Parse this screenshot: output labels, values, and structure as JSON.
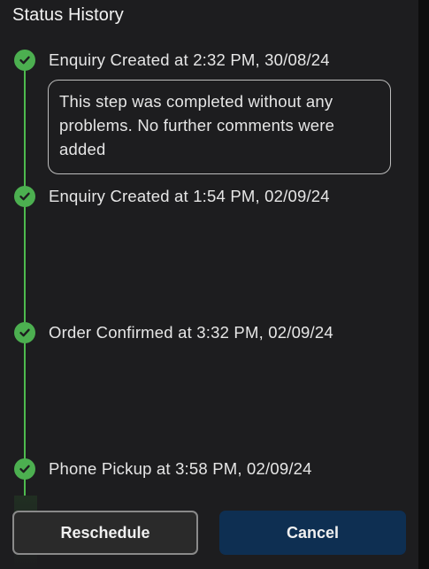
{
  "section": {
    "title": "Status History"
  },
  "timeline": {
    "steps": [
      {
        "label": "Enquiry Created at 2:32 PM, 30/08/24",
        "icon": "check-circle-icon"
      },
      {
        "label": "Enquiry Created at 1:54 PM, 02/09/24",
        "icon": "check-circle-icon"
      },
      {
        "label": "Order Confirmed at 3:32 PM, 02/09/24",
        "icon": "check-circle-icon"
      },
      {
        "label": "Phone Pickup at 3:58 PM, 02/09/24",
        "icon": "check-circle-icon"
      }
    ],
    "comment": "This step was completed without any problems. No further comments were added",
    "line_color": "#4eba4e",
    "check_color": "#4caf50"
  },
  "actions": {
    "reschedule_label": "Reschedule",
    "cancel_label": "Cancel",
    "cancel_color": "#0e2f52"
  }
}
